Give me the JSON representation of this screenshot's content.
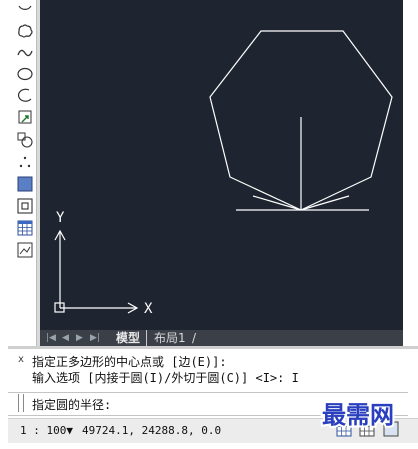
{
  "canvas": {
    "background": "#1f2530",
    "ucs": {
      "x_label": "X",
      "y_label": "Y"
    }
  },
  "toolbar": {
    "tools": [
      "circle-partial-icon",
      "revision-cloud-icon",
      "spline-icon",
      "ellipse-icon",
      "ellipse-arc-icon",
      "insert-block-icon",
      "make-block-icon",
      "point-icon",
      "hatch-icon",
      "region-icon",
      "table-icon",
      "multiline-text-icon"
    ]
  },
  "tabs": {
    "nav": [
      "|◀",
      "◀",
      "▶",
      "▶|"
    ],
    "model": "模型",
    "layout1": "布局1",
    "separator": "/"
  },
  "command": {
    "close_glyph": "x",
    "line1": "指定正多边形的中心点或 [边(E)]:",
    "line2": "输入选项 [内接于圆(I)/外切于圆(C)] <I>: I",
    "prompt": "指定圆的半径:"
  },
  "status": {
    "scale": "1 : 100▼",
    "coords": "49724.1, 24288.8, 0.0"
  },
  "watermark": {
    "text": "最需网",
    "color": "#2a3fbf"
  }
}
